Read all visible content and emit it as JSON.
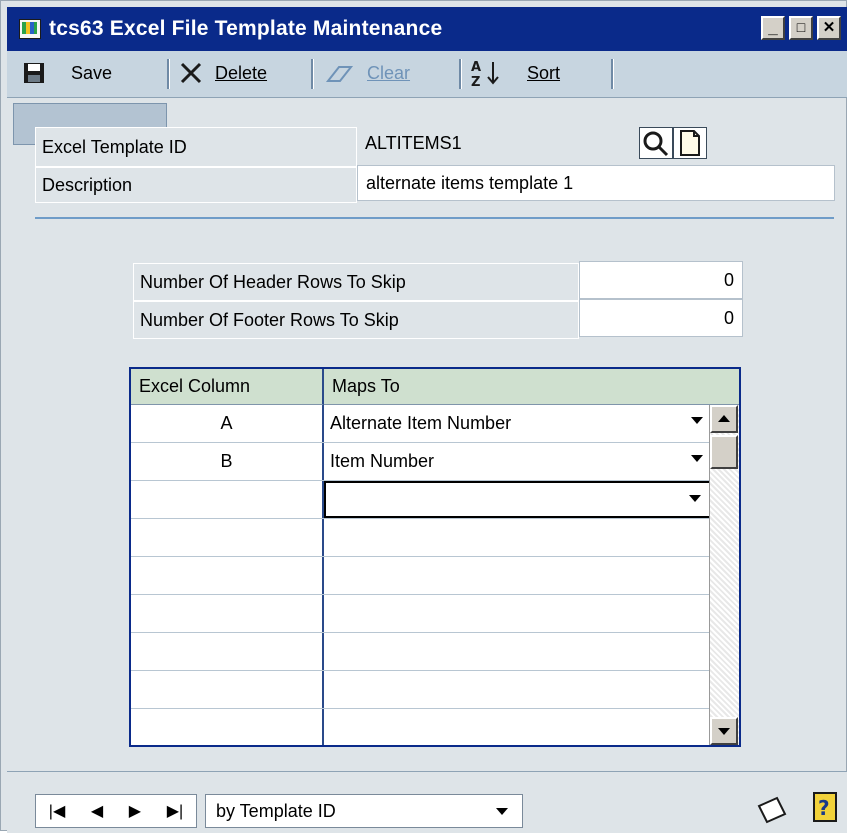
{
  "window": {
    "title": "tcs63 Excel File Template Maintenance",
    "controls": {
      "minimize": "_",
      "maximize": "□",
      "close": "✕"
    }
  },
  "toolbar": {
    "save_label": "Save",
    "delete_label": "Delete",
    "clear_label": "Clear",
    "sort_label": "Sort"
  },
  "form": {
    "template_id_label": "Excel Template ID",
    "template_id_value": "ALTITEMS1",
    "description_label": "Description",
    "description_value": "alternate items template 1",
    "header_rows_label": "Number Of Header Rows To Skip",
    "header_rows_value": "0",
    "footer_rows_label": "Number Of Footer Rows To Skip",
    "footer_rows_value": "0"
  },
  "grid": {
    "columns": [
      "Excel Column",
      "Maps To"
    ],
    "rows": [
      {
        "excel_column": "A",
        "maps_to": "Alternate Item Number"
      },
      {
        "excel_column": "B",
        "maps_to": "Item Number"
      },
      {
        "excel_column": "",
        "maps_to": ""
      }
    ]
  },
  "status": {
    "nav": {
      "first": "|◀",
      "prev": "◀",
      "next": "▶",
      "last": "▶|"
    },
    "sort_by": "by Template ID"
  },
  "colors": {
    "titlebar": "#0a2a8a",
    "toolbar": "#c7d5e0",
    "window_bg": "#dee4e8",
    "grid_header": "#cfe0cf"
  }
}
